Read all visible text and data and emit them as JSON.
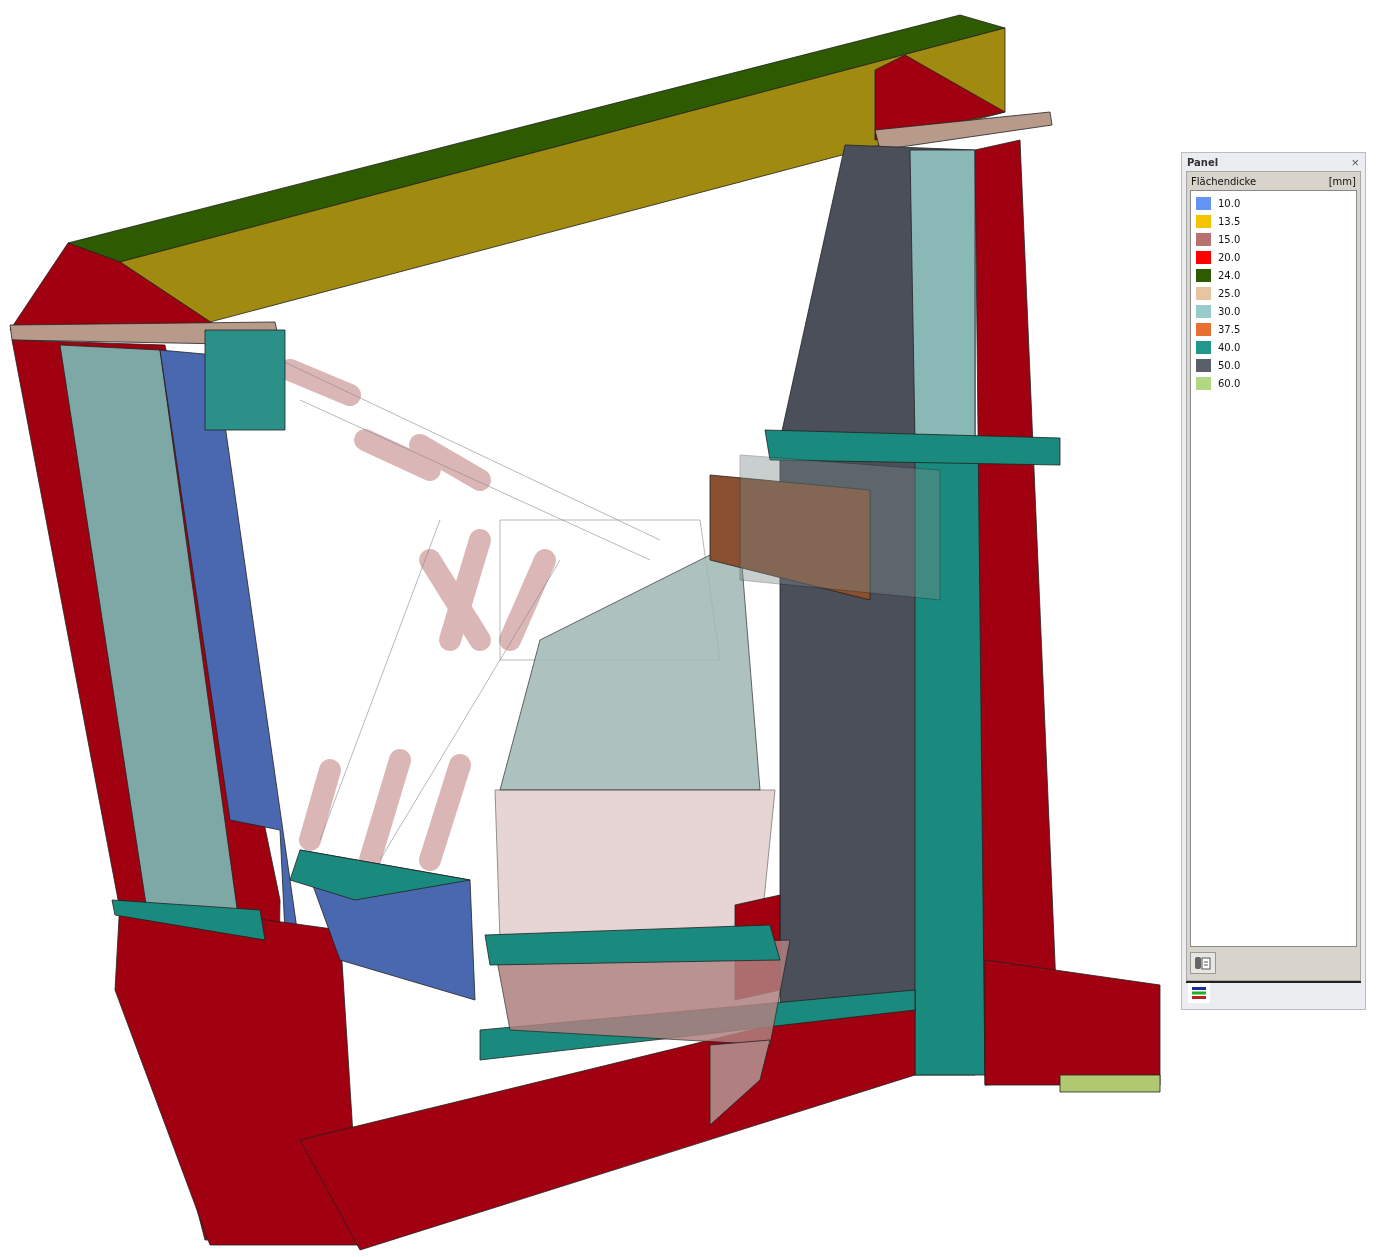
{
  "panel": {
    "title": "Panel",
    "close": "×",
    "legend": {
      "title": "Flächendicke",
      "unit": "[mm]",
      "items": [
        {
          "label": "10.0",
          "color": "#6495f5"
        },
        {
          "label": "13.5",
          "color": "#f5c400"
        },
        {
          "label": "15.0",
          "color": "#b87070"
        },
        {
          "label": "20.0",
          "color": "#ff0000"
        },
        {
          "label": "24.0",
          "color": "#2e5a00"
        },
        {
          "label": "25.0",
          "color": "#e8c4a0"
        },
        {
          "label": "30.0",
          "color": "#98cccc"
        },
        {
          "label": "37.5",
          "color": "#e87030"
        },
        {
          "label": "40.0",
          "color": "#20998a"
        },
        {
          "label": "50.0",
          "color": "#5a5f6a"
        },
        {
          "label": "60.0",
          "color": "#b0d880"
        }
      ]
    }
  }
}
